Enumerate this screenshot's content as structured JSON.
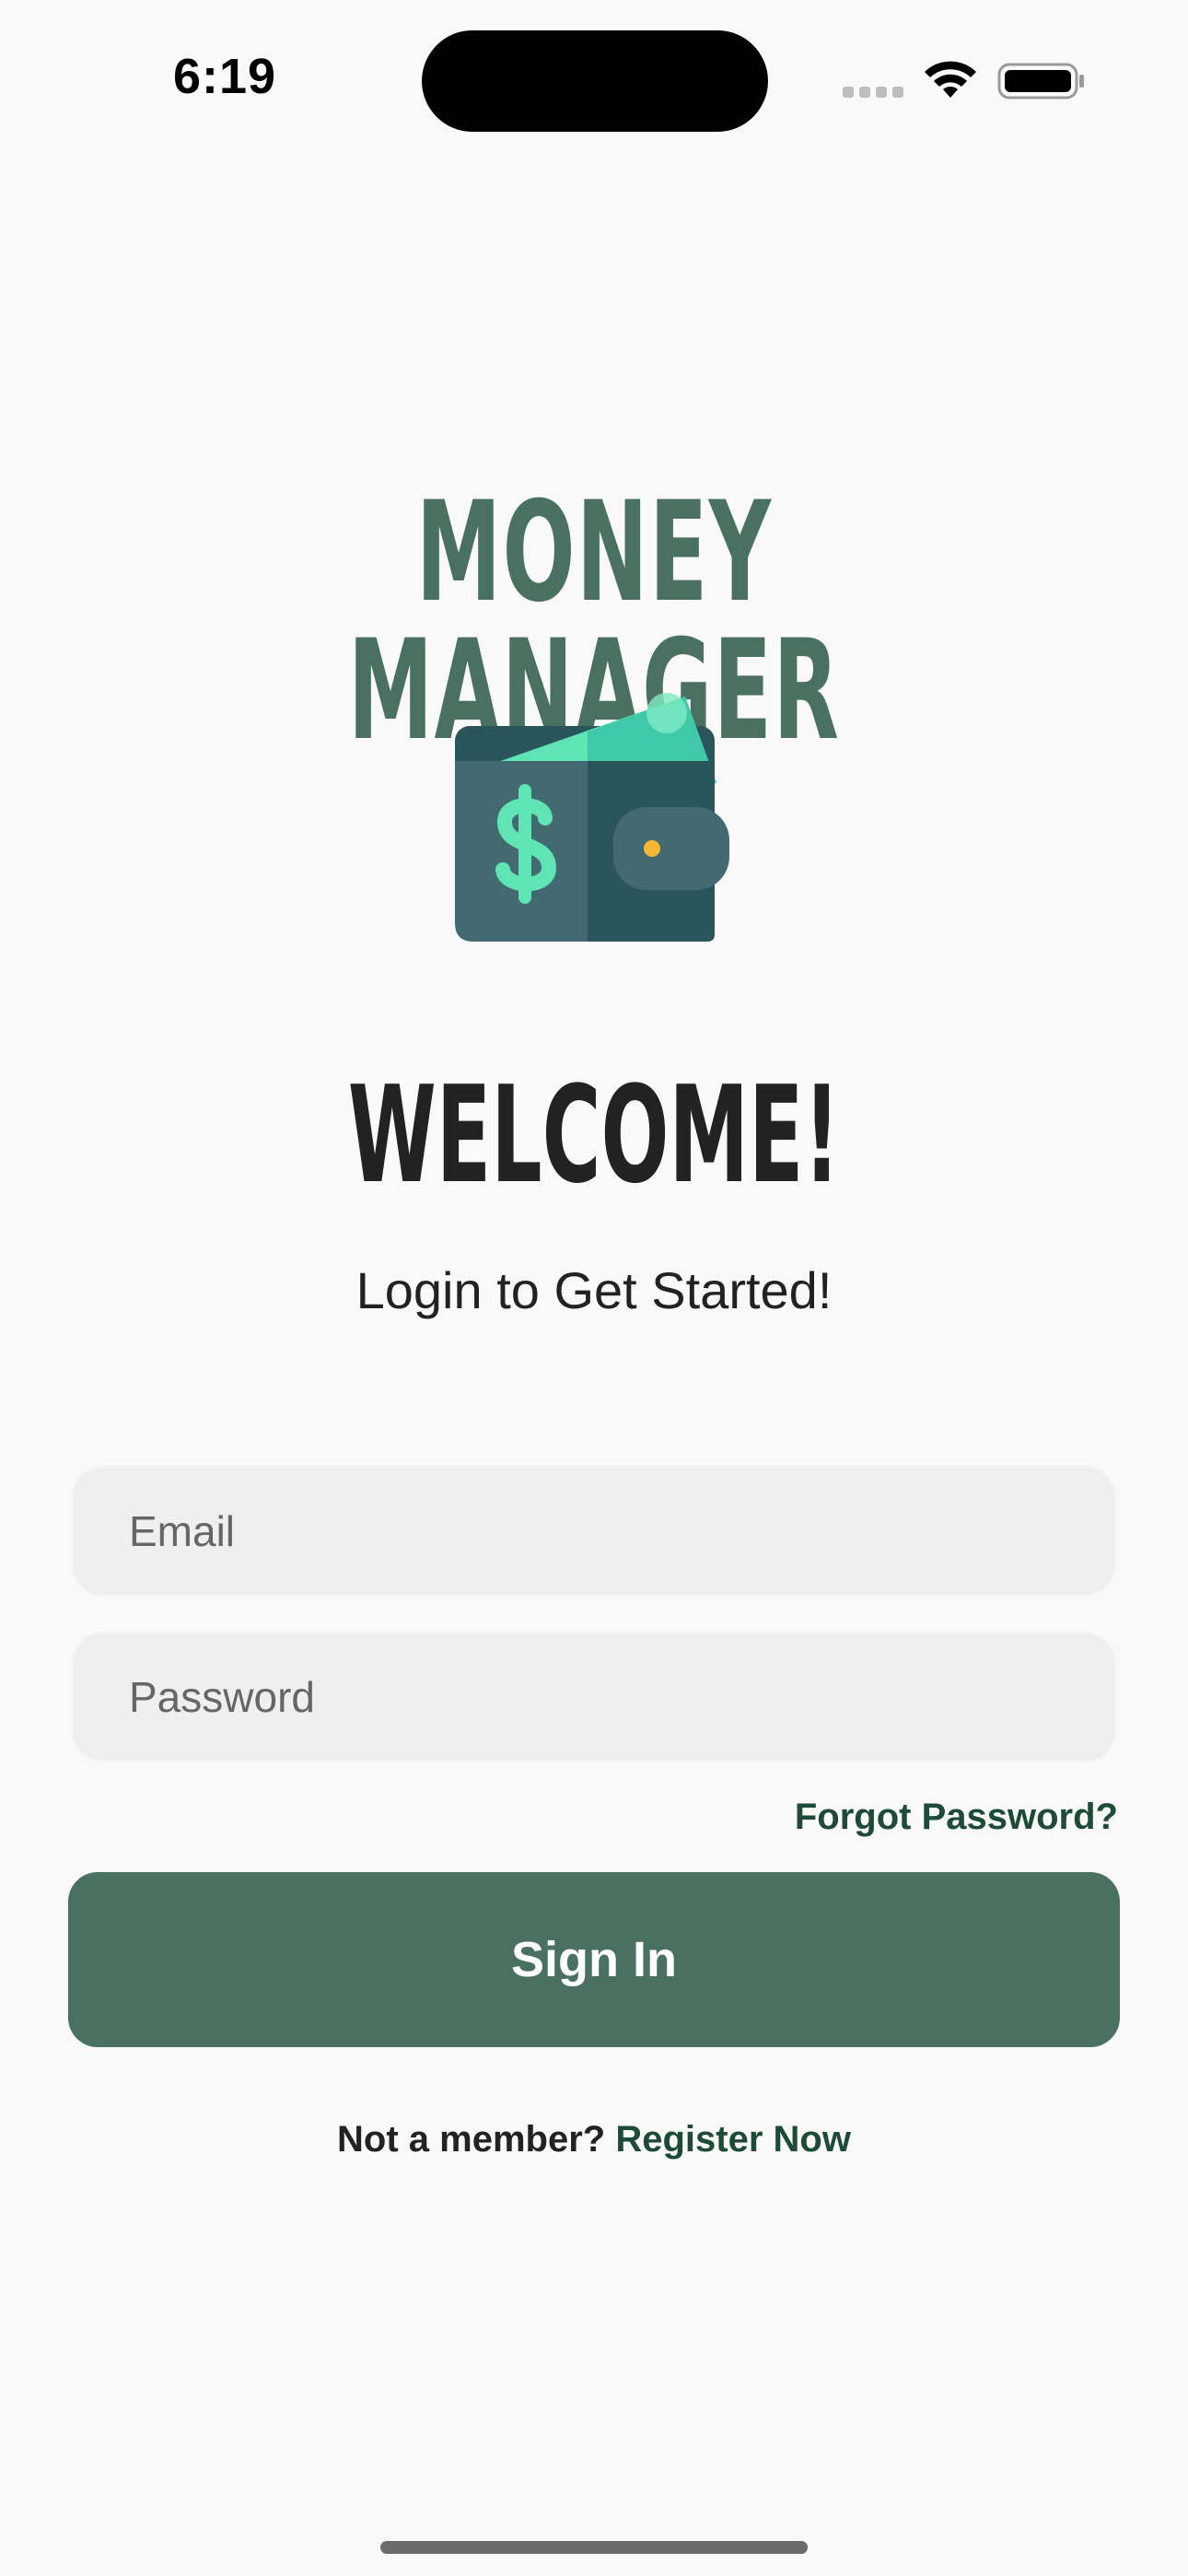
{
  "status_bar": {
    "time": "6:19",
    "icons": [
      "signal-dots-icon",
      "wifi-icon",
      "battery-icon"
    ]
  },
  "app": {
    "title": "MONEY MANAGER",
    "logo_icon": "wallet-dollar-icon"
  },
  "welcome": {
    "heading": "WELCOME!",
    "subtitle": "Login to Get Started!"
  },
  "form": {
    "email_placeholder": "Email",
    "password_placeholder": "Password",
    "forgot_label": "Forgot Password?",
    "signin_label": "Sign In"
  },
  "register": {
    "prompt": "Not a member?",
    "link_label": "Register Now"
  },
  "colors": {
    "background": "#F9F9F9",
    "brand_green": "#4A7062",
    "link_green": "#1E4A38",
    "input_bg": "#EFEFEF",
    "wallet_dark": "#2A555C",
    "wallet_light": "#436A70",
    "money_mint": "#5EE4B5",
    "clasp_dot": "#F5B731"
  }
}
